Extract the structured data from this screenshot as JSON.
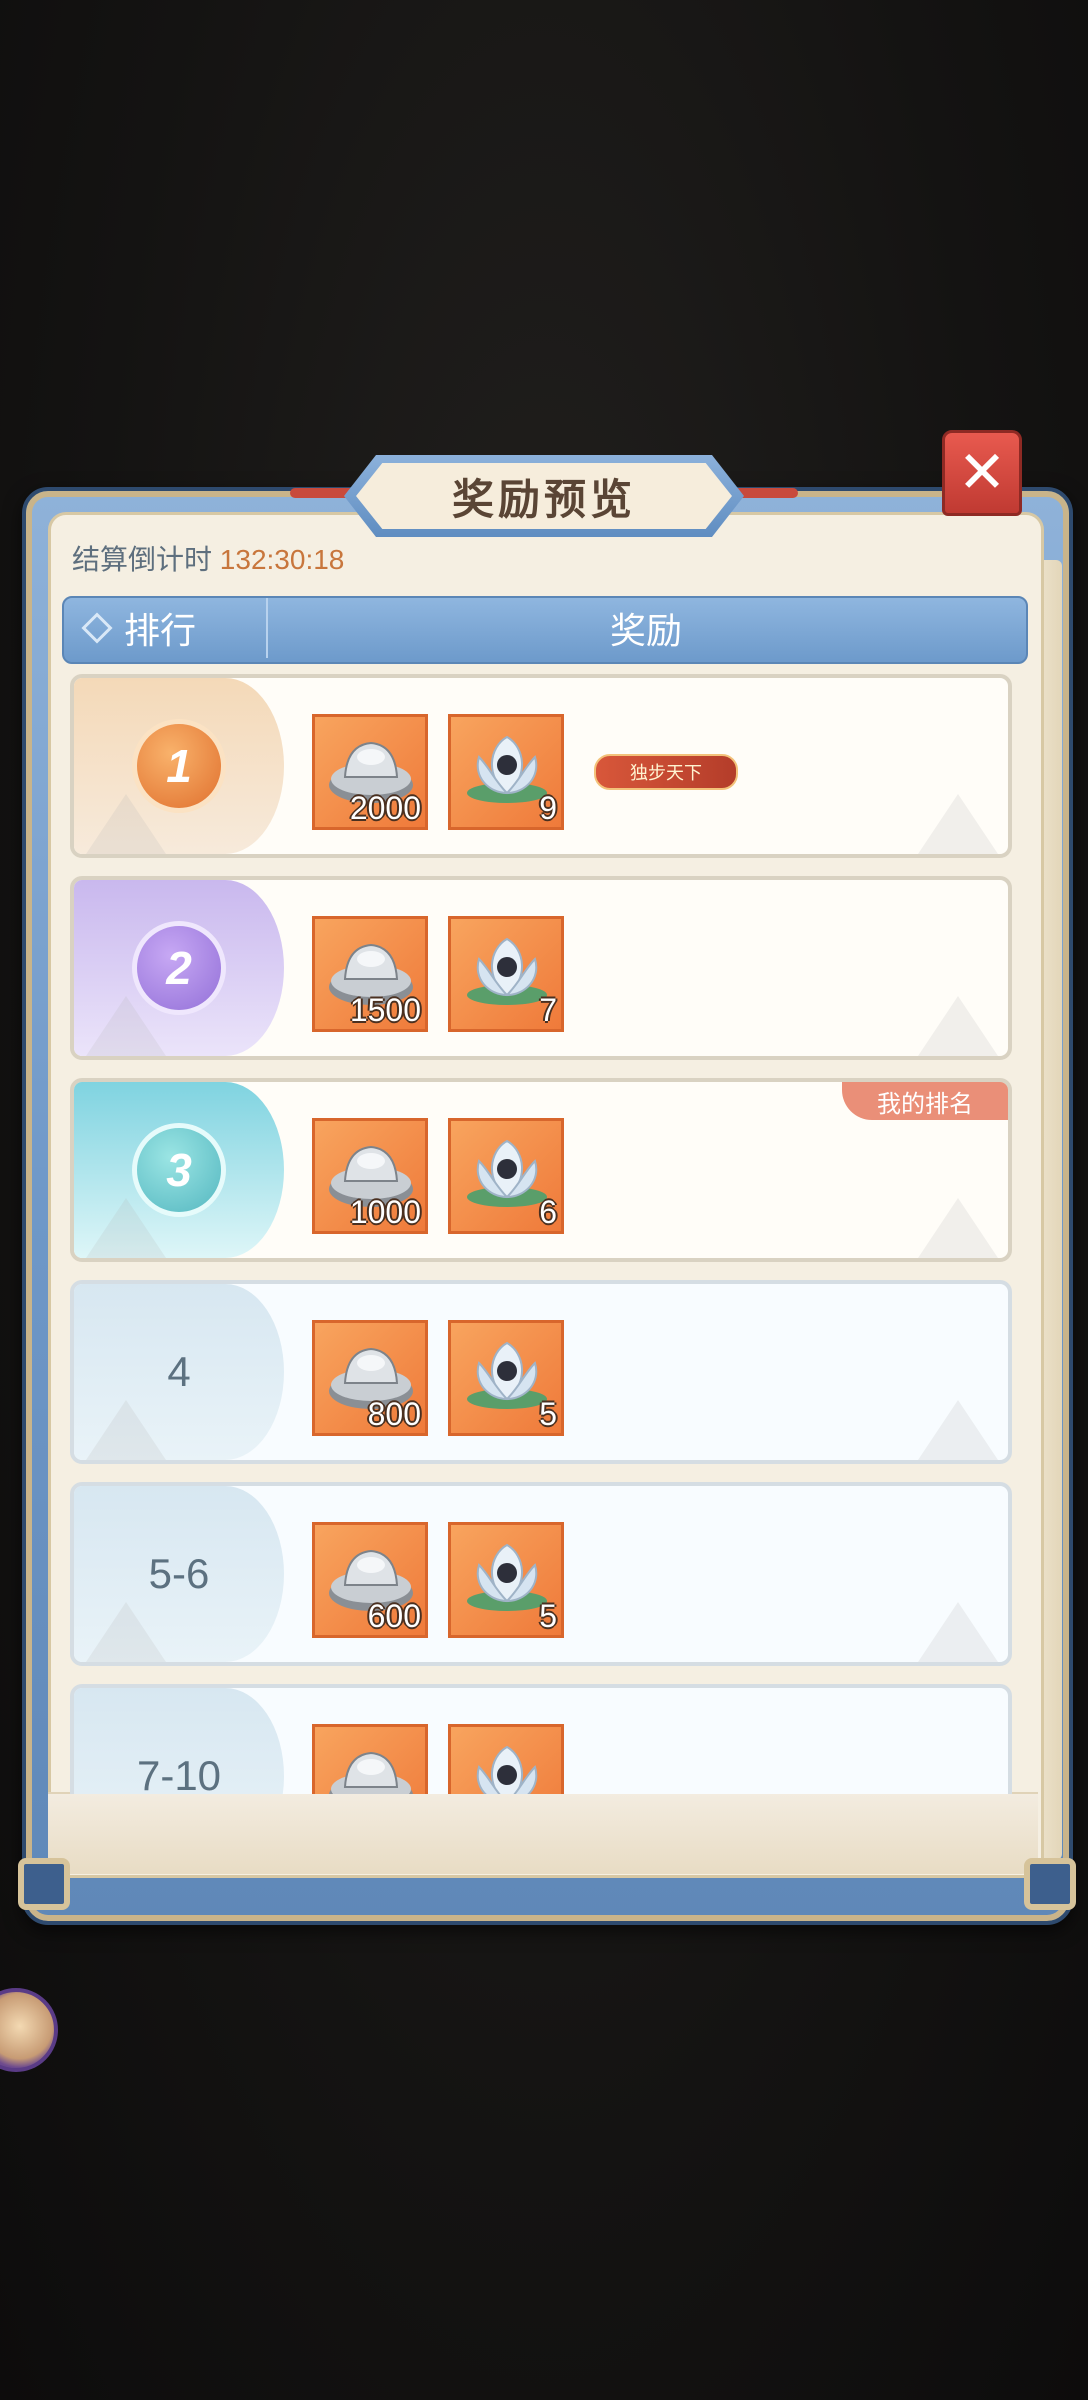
{
  "dialog": {
    "title": "奖励预览",
    "close_symbol": "✕",
    "countdown_label": "结算倒计时",
    "countdown_value": "132:30:18"
  },
  "table_header": {
    "rank": "排行",
    "reward": "奖励"
  },
  "my_rank_label": "我的排名",
  "rows": [
    {
      "rank": "1",
      "style": "gold",
      "silver": "2000",
      "lotus": "9",
      "title_badge": "独步天下"
    },
    {
      "rank": "2",
      "style": "purple",
      "silver": "1500",
      "lotus": "7"
    },
    {
      "rank": "3",
      "style": "teal",
      "silver": "1000",
      "lotus": "6",
      "is_mine": true
    },
    {
      "rank": "4",
      "style": "blue",
      "silver": "800",
      "lotus": "5"
    },
    {
      "rank": "5-6",
      "style": "blue",
      "silver": "600",
      "lotus": "5"
    },
    {
      "rank": "7-10",
      "style": "blue",
      "silver": "",
      "lotus": ""
    }
  ],
  "icons": {
    "silver": "silver-ingot-icon",
    "lotus": "lotus-icon"
  },
  "colors": {
    "countdown_value": "#c8763c",
    "item_bg": "#f28a45",
    "header_bar": "#7da7d6",
    "my_rank_tag": "#ea8f78"
  }
}
